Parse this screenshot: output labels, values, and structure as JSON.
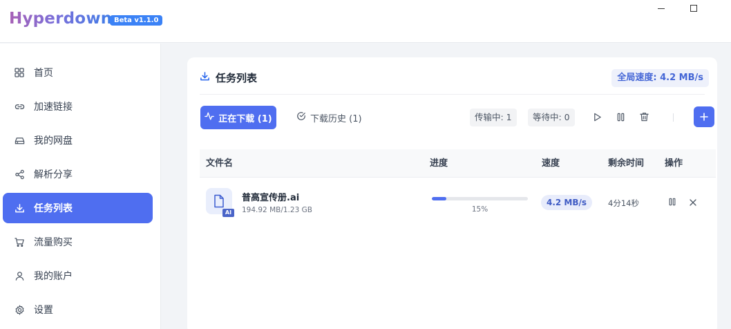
{
  "app": {
    "title": "Hyperdown",
    "badge": "Beta v1.1.0",
    "colors": {
      "accent": "#4f6ef0",
      "logo_start": "#a760b6",
      "logo_end": "#3f7de8"
    }
  },
  "window_controls": [
    "minimize-icon",
    "maximize-icon"
  ],
  "sidebar": {
    "items": [
      {
        "label": "首页",
        "icon": "grid-icon",
        "active": false
      },
      {
        "label": "加速链接",
        "icon": "link-icon",
        "active": false
      },
      {
        "label": "我的网盘",
        "icon": "drive-icon",
        "active": false
      },
      {
        "label": "解析分享",
        "icon": "share-icon",
        "active": false
      },
      {
        "label": "任务列表",
        "icon": "download-icon",
        "active": true
      },
      {
        "label": "流量购买",
        "icon": "cart-icon",
        "active": false
      },
      {
        "label": "我的账户",
        "icon": "user-icon",
        "active": false
      },
      {
        "label": "设置",
        "icon": "gear-icon",
        "active": false
      }
    ]
  },
  "main": {
    "title": "任务列表",
    "global_speed": "全局速度: 4.2 MB/s",
    "tabs": [
      {
        "label": "正在下载 (1)",
        "icon": "activity-icon",
        "active": true
      },
      {
        "label": "下载历史 (1)",
        "icon": "check-circle-icon",
        "active": false
      }
    ],
    "stats": {
      "transferring": "传输中: 1",
      "waiting": "等待中: 0"
    },
    "table": {
      "columns": [
        "文件名",
        "进度",
        "速度",
        "剩余时间",
        "操作"
      ],
      "rows": [
        {
          "name": "普高宣传册.ai",
          "size": "194.92 MB/1.23 GB",
          "type_tag": "AI",
          "progress": 0.15,
          "progress_text": "15%",
          "speed": "4.2 MB/s",
          "remaining": "4分14秒"
        }
      ]
    }
  }
}
